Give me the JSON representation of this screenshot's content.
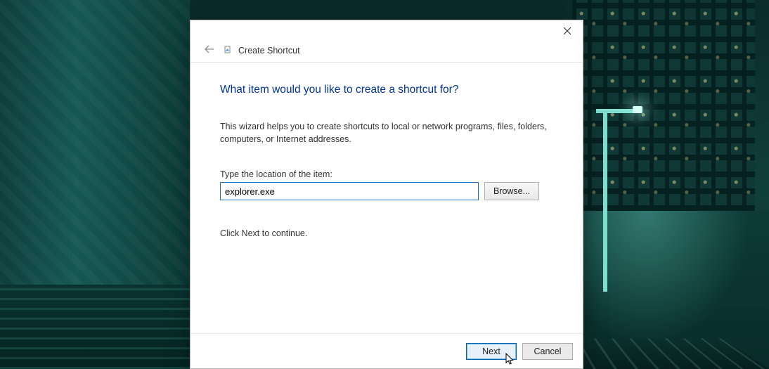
{
  "dialog": {
    "breadcrumb": "Create Shortcut",
    "heading": "What item would you like to create a shortcut for?",
    "description": "This wizard helps you to create shortcuts to local or network programs, files, folders, computers, or Internet addresses.",
    "location_label": "Type the location of the item:",
    "location_value": "explorer.exe",
    "browse_label": "Browse...",
    "continue_hint": "Click Next to continue.",
    "next_label": "Next",
    "cancel_label": "Cancel"
  }
}
